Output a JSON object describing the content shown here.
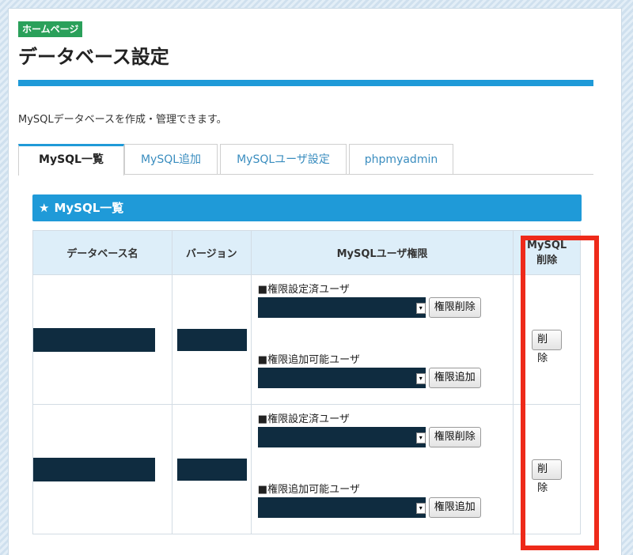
{
  "breadcrumb": "ホームページ",
  "page_title": "データベース設定",
  "description": "MySQLデータベースを作成・管理できます。",
  "tabs": [
    {
      "label": "MySQL一覧",
      "active": true
    },
    {
      "label": "MySQL追加",
      "active": false
    },
    {
      "label": "MySQLユーザ設定",
      "active": false
    },
    {
      "label": "phpmyadmin",
      "active": false
    }
  ],
  "section": {
    "icon": "star-icon",
    "title": "MySQL一覧"
  },
  "table": {
    "headers": {
      "db_name": "データベース名",
      "version": "バージョン",
      "user_perm": "MySQLユーザ権限",
      "delete_line1": "MySQL",
      "delete_line2": "削除"
    },
    "rows": [
      {
        "granted_label": "■権限設定済ユーザ",
        "revoke_button": "権限削除",
        "addable_label": "■権限追加可能ユーザ",
        "grant_button": "権限追加",
        "delete_button": "削除"
      },
      {
        "granted_label": "■権限設定済ユーザ",
        "revoke_button": "権限削除",
        "addable_label": "■権限追加可能ユーザ",
        "grant_button": "権限追加",
        "delete_button": "削除"
      }
    ]
  },
  "colors": {
    "accent": "#1f9ad8",
    "breadcrumb_bg": "#2aa05a",
    "highlight": "#ee2a1a",
    "redaction": "#0f2c40"
  }
}
